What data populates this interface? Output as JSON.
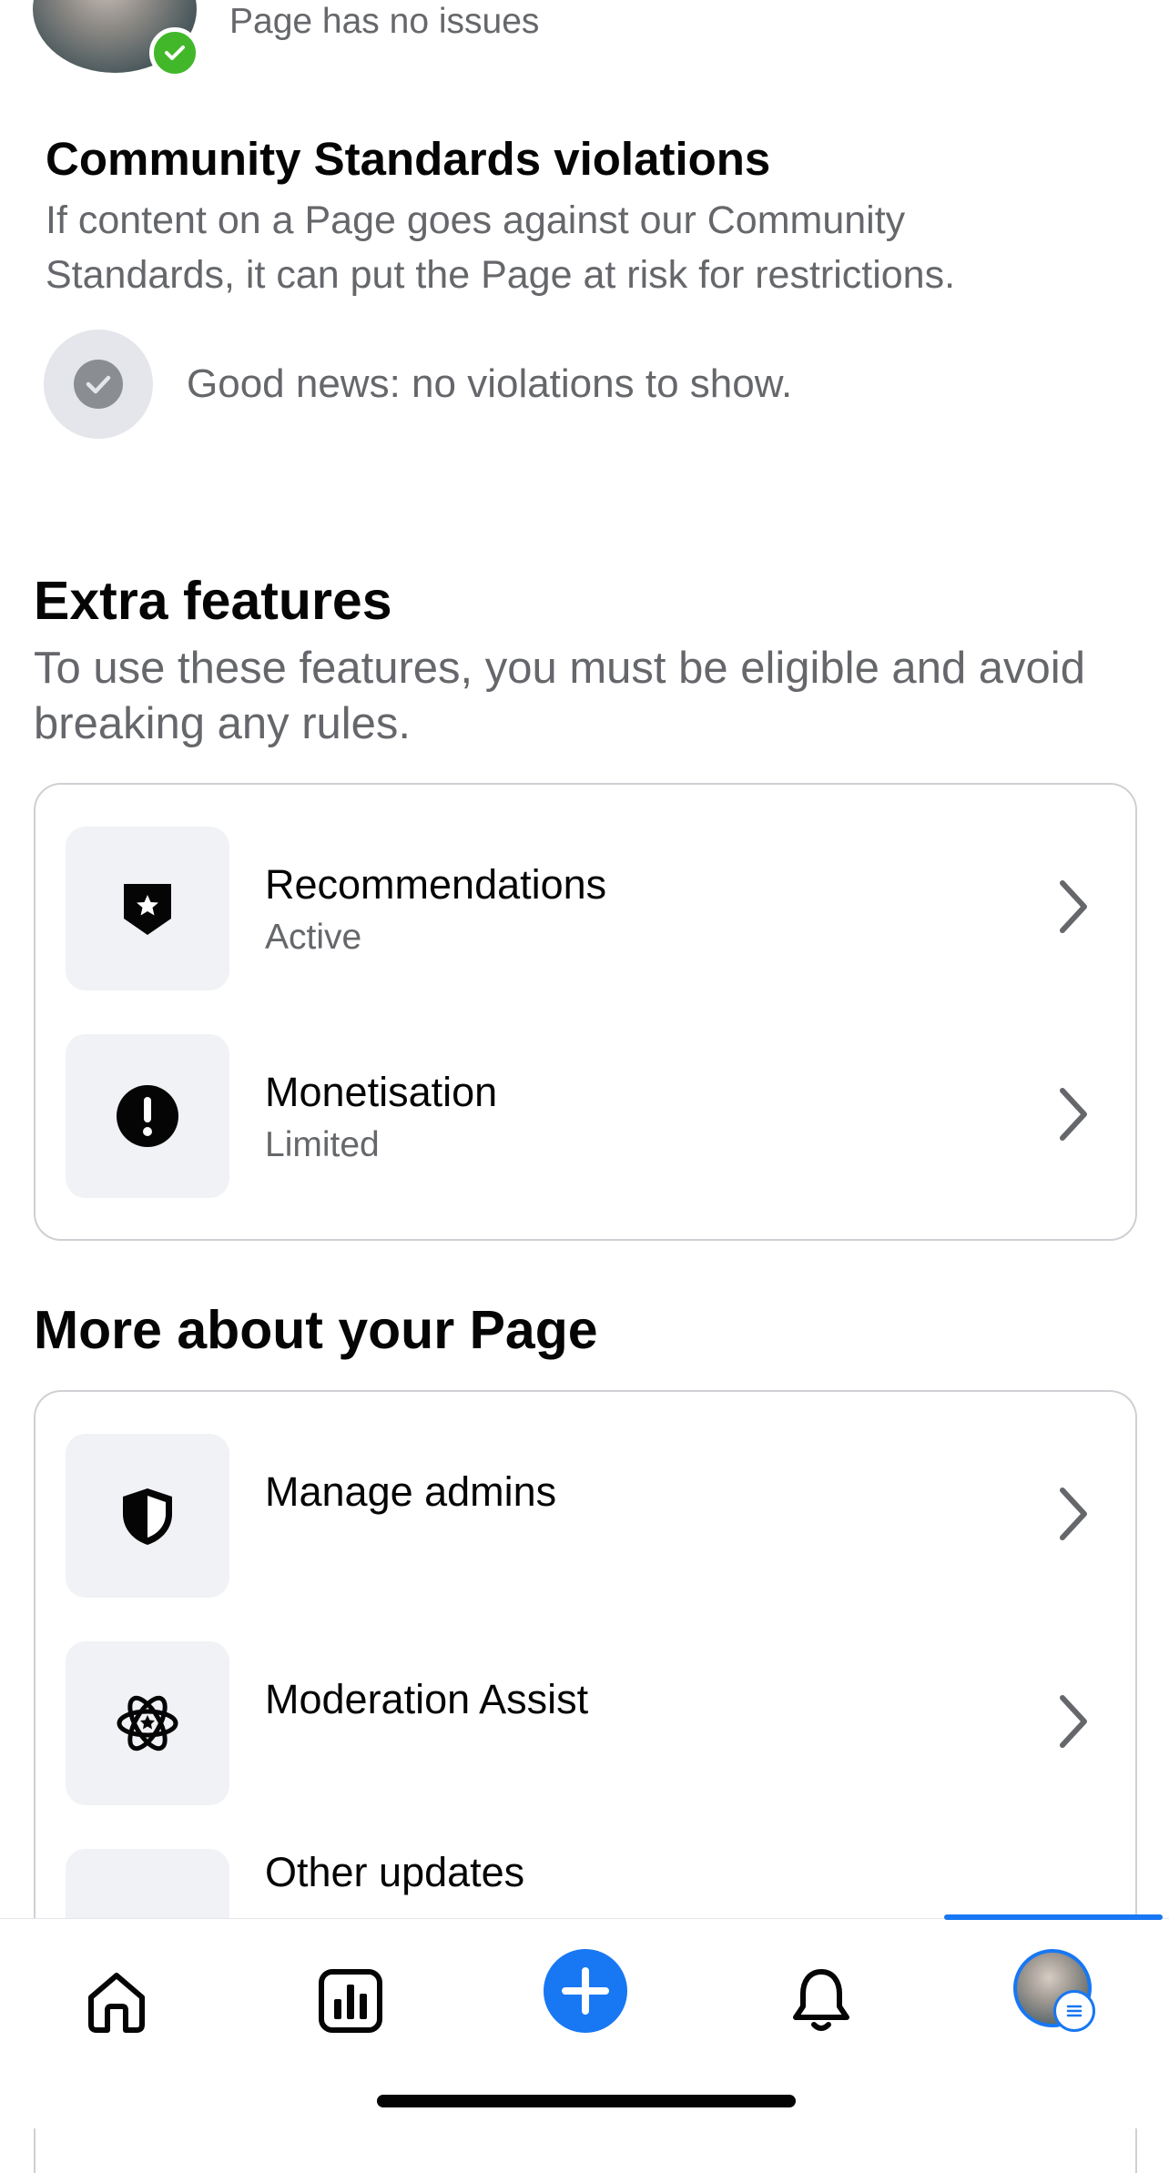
{
  "page_status": {
    "text": "Page has no issues"
  },
  "violations": {
    "title": "Community Standards violations",
    "description": "If content on a Page goes against our Community Standards, it can put the Page at risk for restrictions.",
    "status_text": "Good news: no violations to show."
  },
  "extra_features": {
    "title": "Extra features",
    "description": "To use these features, you must be eligible and avoid breaking any rules.",
    "items": [
      {
        "label": "Recommendations",
        "status": "Active",
        "icon": "shield-star-icon"
      },
      {
        "label": "Monetisation",
        "status": "Limited",
        "icon": "exclamation-circle-icon"
      }
    ]
  },
  "more_about": {
    "title": "More about your Page",
    "items": [
      {
        "label": "Manage admins",
        "icon": "shield-icon"
      },
      {
        "label": "Moderation Assist",
        "icon": "atom-star-icon"
      },
      {
        "label": "Other updates",
        "icon": "megaphone-icon"
      }
    ]
  },
  "bottom_nav": {
    "items": [
      "home-icon",
      "insights-icon",
      "create-icon",
      "notifications-icon",
      "profile-avatar"
    ],
    "active": "profile-avatar",
    "accent": "#1877f2"
  },
  "colors": {
    "success": "#42b72a",
    "secondary_text": "#65676b",
    "tile_bg": "#f0f2f5"
  }
}
